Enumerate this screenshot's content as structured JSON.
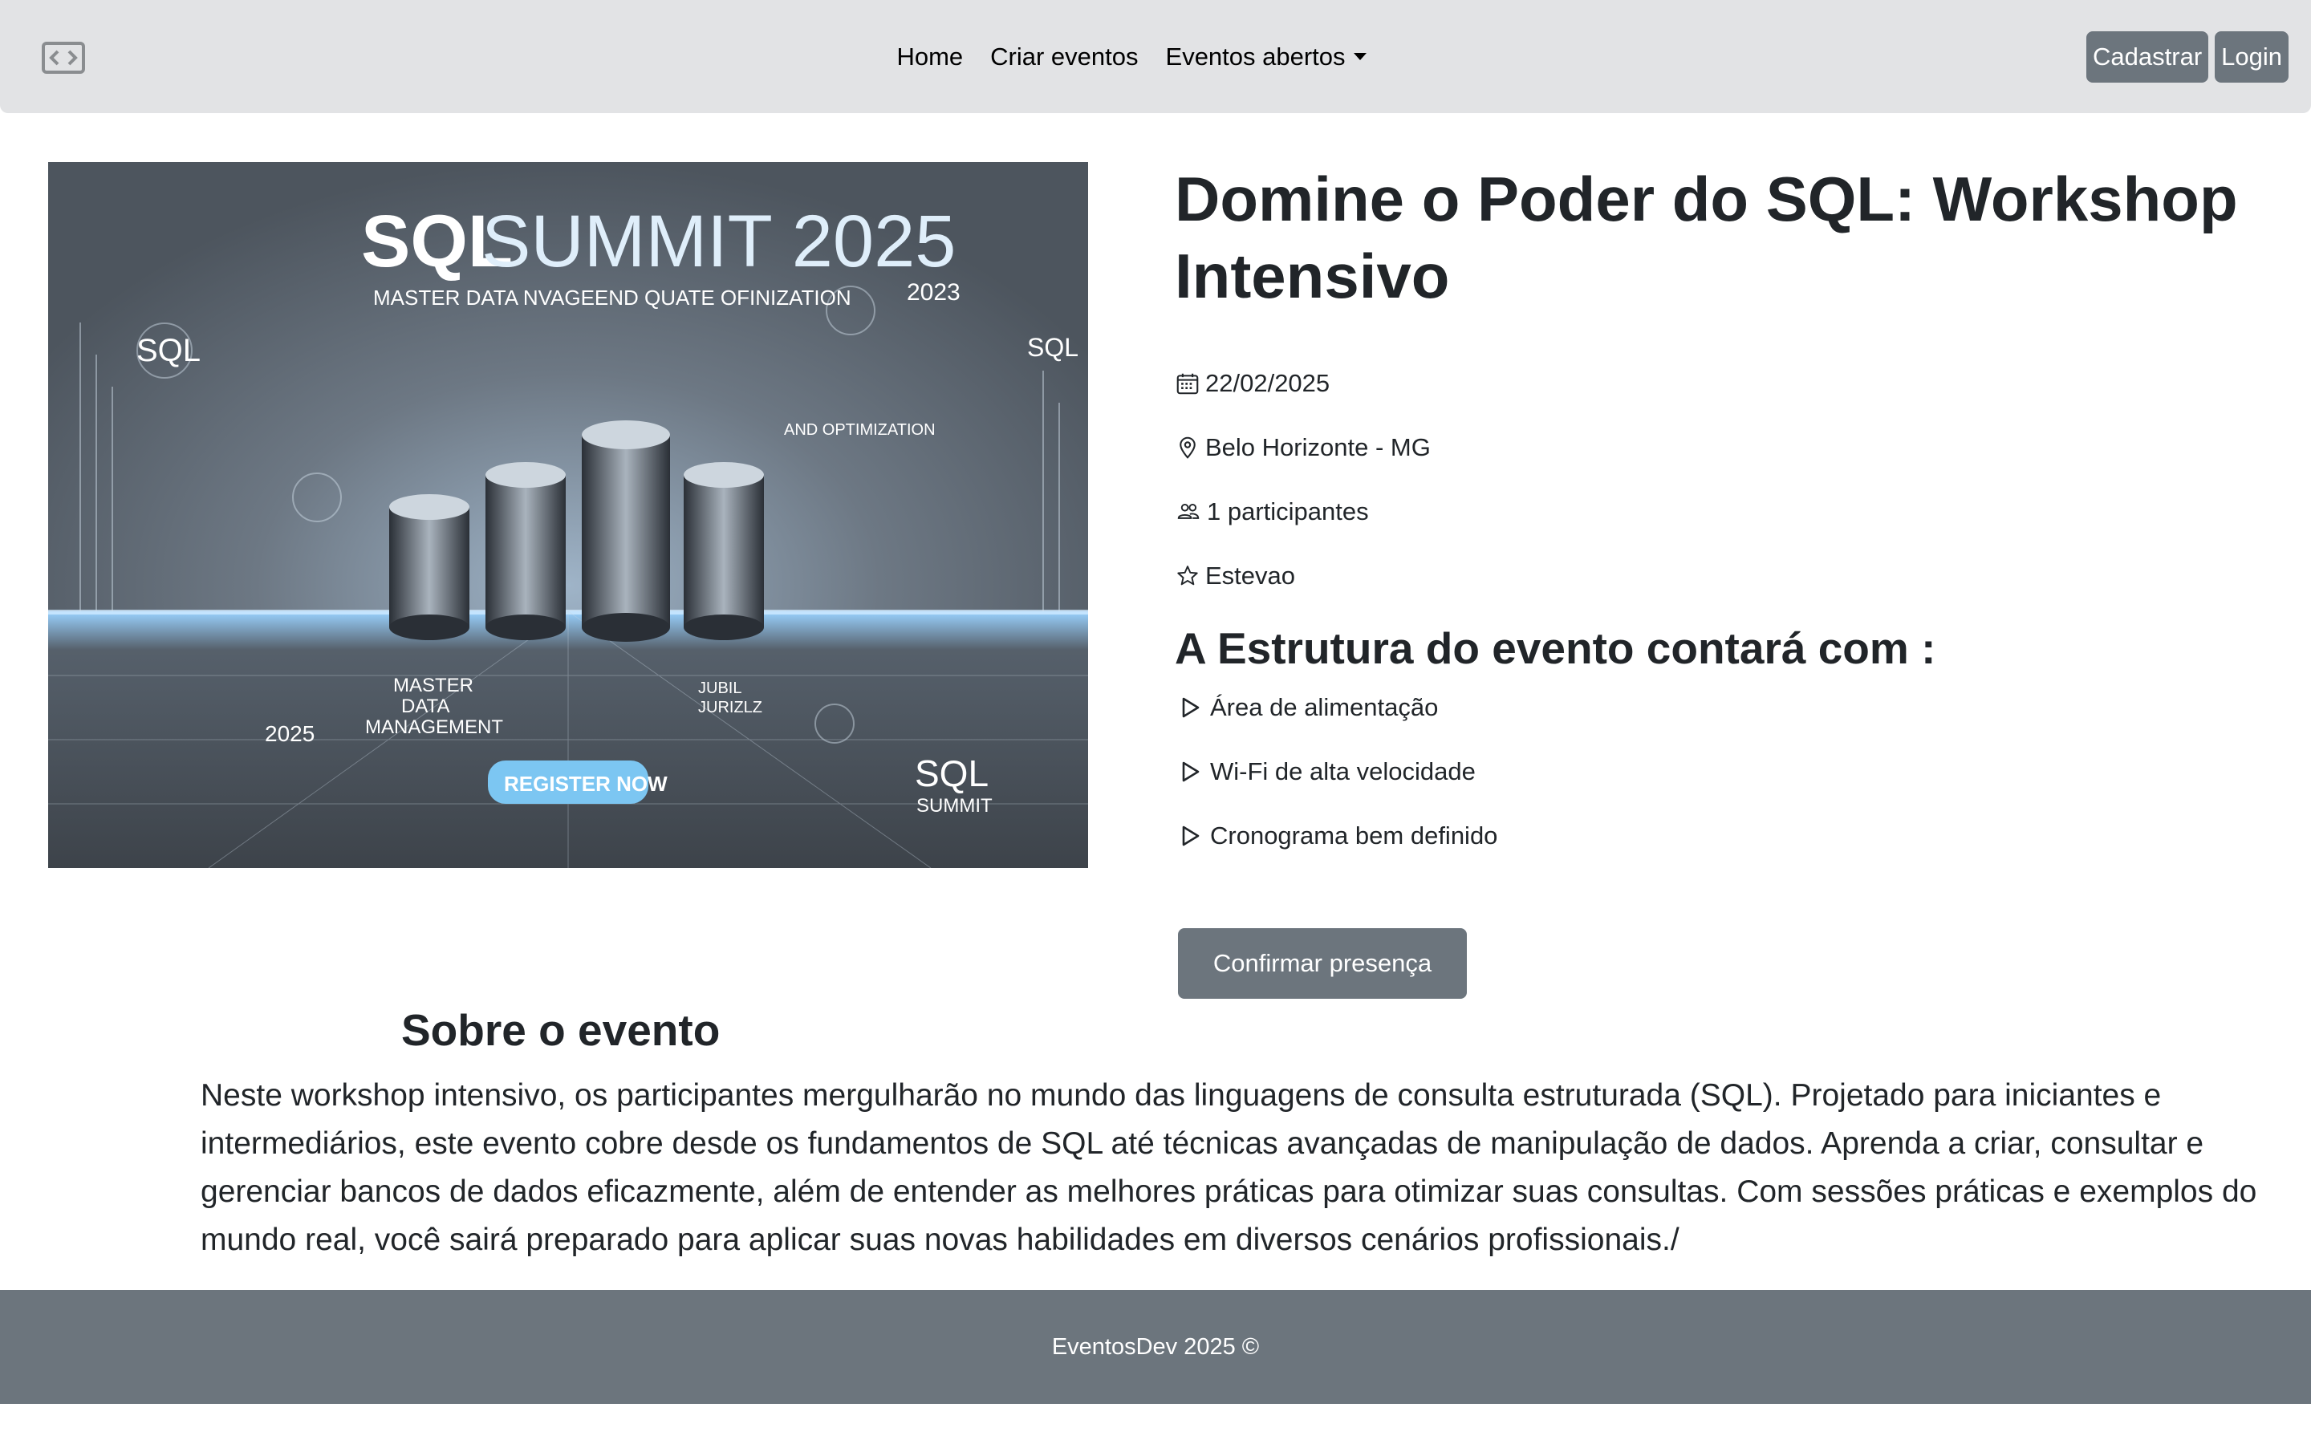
{
  "nav": {
    "links": [
      "Home",
      "Criar eventos",
      "Eventos abertos"
    ],
    "register_label": "Cadastrar",
    "login_label": "Login"
  },
  "hero_image": {
    "title_bold": "SQL",
    "title_rest": "SUMMIT 2025",
    "tagline": "MASTER DATA NVAGEEND QUATE OFINIZATION",
    "sql_label_left": "SQL",
    "sql_label_right": "SQL",
    "year_top": "2023",
    "year_bottom": "2025",
    "optimization": "AND OPTIMIZATION",
    "mdm_line1": "MASTER",
    "mdm_line2": "DATA",
    "mdm_line3": "MANAGEMENT",
    "jubil_line1": "JUBIL",
    "jubil_line2": "JURIZLZ",
    "register_button": "REGISTER NOW",
    "corner_sql": "SQL",
    "corner_summit": "SUMMIT"
  },
  "event": {
    "title": "Domine o Poder do SQL: Workshop Intensivo",
    "date": "22/02/2025",
    "location": "Belo Horizonte - MG",
    "participants": "1 participantes",
    "organizer": "Estevao",
    "structure_title": "A Estrutura do evento contará com :",
    "features": [
      "Área de alimentação",
      "Wi-Fi de alta velocidade",
      "Cronograma bem definido"
    ],
    "confirm_label": "Confirmar presença"
  },
  "about": {
    "title": "Sobre o evento",
    "text": "Neste workshop intensivo, os participantes mergulharão no mundo das linguagens de consulta estruturada (SQL). Projetado para iniciantes e intermediários, este evento cobre desde os fundamentos de SQL até técnicas avançadas de manipulação de dados. Aprenda a criar, consultar e gerenciar bancos de dados eficazmente, além de entender as melhores práticas para otimizar suas consultas. Com sessões práticas e exemplos do mundo real, você sairá preparado para aplicar suas novas habilidades em diversos cenários profissionais./"
  },
  "footer": {
    "text": "EventosDev 2025 ©"
  },
  "colors": {
    "navbar_bg": "#e2e3e5",
    "button_bg": "#6c757d",
    "footer_bg": "#6c757d"
  }
}
